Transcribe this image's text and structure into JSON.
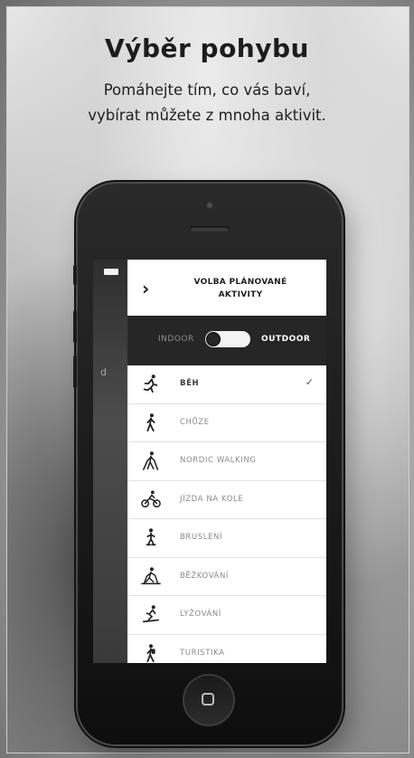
{
  "hero": {
    "title": "Výběr pohybu",
    "subtitle_line1": "Pomáhejte tím, co vás baví,",
    "subtitle_line2": "vybírat můžete z mnoha aktivit."
  },
  "screen": {
    "back_glyph": "›",
    "header_line1": "VOLBA PLÁNOVANÉ",
    "header_line2": "AKTIVITY",
    "toggle": {
      "left_label": "INDOOR",
      "right_label": "OUTDOOR",
      "selected": "OUTDOOR"
    },
    "side_letter": "d",
    "activities": [
      {
        "label": "BĚH",
        "icon": "running-icon",
        "selected": true
      },
      {
        "label": "CHŮZE",
        "icon": "walking-icon",
        "selected": false
      },
      {
        "label": "NORDIC WALKING",
        "icon": "nordic-walking-icon",
        "selected": false
      },
      {
        "label": "JÍZDA NA KOLE",
        "icon": "cycling-icon",
        "selected": false
      },
      {
        "label": "BRUSLENÍ",
        "icon": "skating-icon",
        "selected": false
      },
      {
        "label": "BĚŽKOVÁNÍ",
        "icon": "cross-country-ski-icon",
        "selected": false
      },
      {
        "label": "LYŽOVÁNÍ",
        "icon": "skiing-icon",
        "selected": false
      },
      {
        "label": "TURISTIKA",
        "icon": "hiking-icon",
        "selected": false
      }
    ],
    "check_glyph": "✓"
  }
}
